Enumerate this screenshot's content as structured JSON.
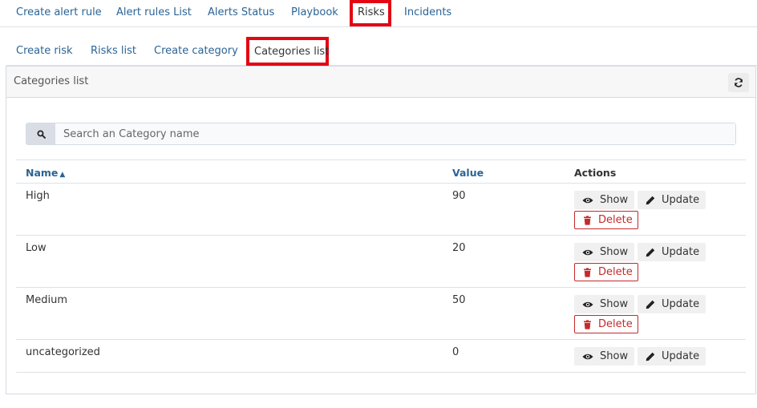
{
  "top_tabs": [
    {
      "label": "Create alert rule"
    },
    {
      "label": "Alert rules List"
    },
    {
      "label": "Alerts Status"
    },
    {
      "label": "Playbook"
    },
    {
      "label": "Risks"
    },
    {
      "label": "Incidents"
    }
  ],
  "sub_tabs": [
    {
      "label": "Create risk"
    },
    {
      "label": "Risks list"
    },
    {
      "label": "Create category"
    },
    {
      "label": "Categories list"
    }
  ],
  "panel": {
    "title": "Categories list",
    "refresh_icon": "refresh-icon"
  },
  "search": {
    "placeholder": "Search an Category name",
    "value": "",
    "icon": "search-icon"
  },
  "table": {
    "columns": {
      "name": "Name",
      "value": "Value",
      "actions": "Actions"
    },
    "sort_indicator": "▲",
    "rows": [
      {
        "name": "High",
        "value": "90"
      },
      {
        "name": "Low",
        "value": "20"
      },
      {
        "name": "Medium",
        "value": "50"
      },
      {
        "name": "uncategorized",
        "value": "0"
      }
    ],
    "actions": {
      "show": "Show",
      "update": "Update",
      "delete": "Delete"
    }
  },
  "colors": {
    "link": "#2a6496",
    "highlight": "#e30613",
    "danger": "#c52a2a"
  }
}
